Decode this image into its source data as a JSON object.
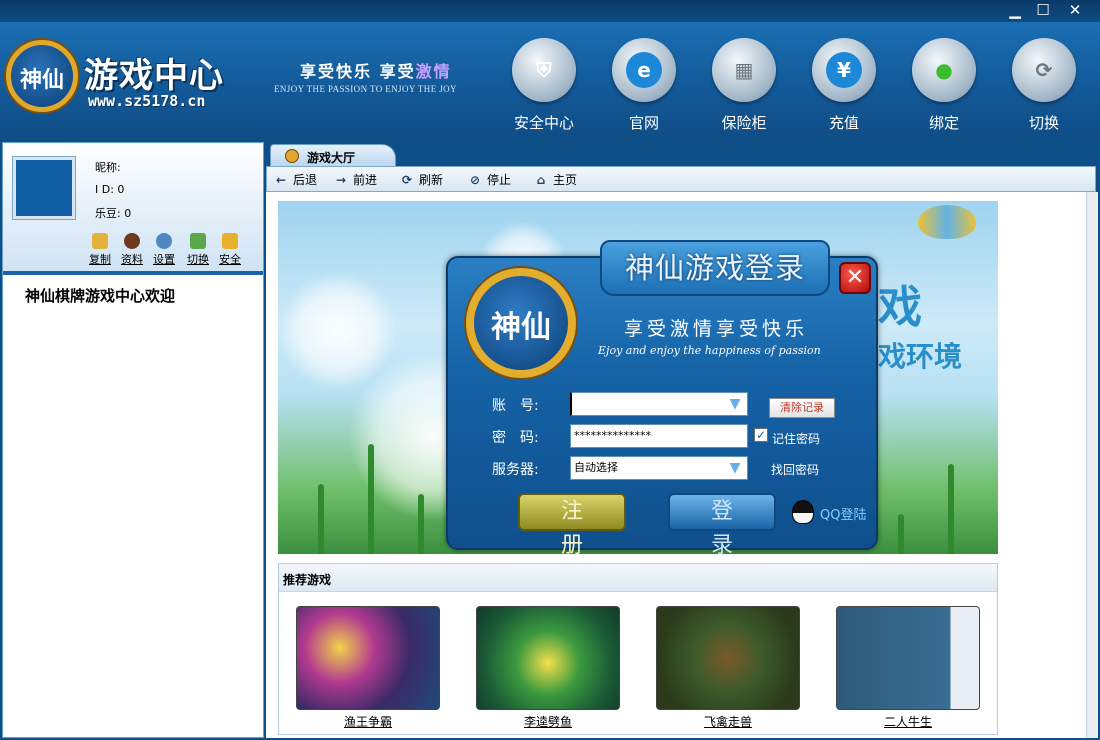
{
  "window": {
    "controls": {
      "minimize": "▁",
      "maximize": "☐",
      "close": "✕"
    }
  },
  "header": {
    "logo_badge_text": "神仙",
    "logo_title": "游戏中心",
    "logo_url": "www.sz5178.cn",
    "slogan_cn_main": "享受快乐 享受",
    "slogan_cn_highlight": "激情",
    "slogan_en": "ENJOY THE PASSION TO ENJOY THE JOY",
    "nav": [
      {
        "label": "安全中心",
        "icon": "shield-icon",
        "glyph": "⛨",
        "color": "#1b1b1b"
      },
      {
        "label": "官网",
        "icon": "browser-icon",
        "glyph": "e",
        "color": "#1e88d8"
      },
      {
        "label": "保险柜",
        "icon": "safe-icon",
        "glyph": "▦",
        "color": "#8a969f"
      },
      {
        "label": "充值",
        "icon": "yen-icon",
        "glyph": "¥",
        "color": "#1e88d8"
      },
      {
        "label": "绑定",
        "icon": "wechat-icon",
        "glyph": "●",
        "color": "#3dbb2f"
      },
      {
        "label": "切换",
        "icon": "switch-icon",
        "glyph": "⟳",
        "color": "#8a969f"
      }
    ]
  },
  "user": {
    "nickname_label": "昵称:",
    "id_label": "I D: 0",
    "beans_label": "乐豆: 0",
    "actions": [
      {
        "label": "复制",
        "icon": "copy-icon",
        "color": "#e3b23c"
      },
      {
        "label": "资料",
        "icon": "profile-icon",
        "color": "#6b3a1f"
      },
      {
        "label": "设置",
        "icon": "gear-icon",
        "color": "#4f86c2"
      },
      {
        "label": "切换",
        "icon": "switch-user-icon",
        "color": "#5aa84a"
      },
      {
        "label": "安全",
        "icon": "lock-icon",
        "color": "#e6b02a"
      }
    ]
  },
  "welcome": "神仙棋牌游戏中心欢迎",
  "tab": {
    "label": "游戏大厅"
  },
  "toolbar": {
    "back": "后退",
    "forward": "前进",
    "refresh": "刷新",
    "stop": "停止",
    "home": "主页"
  },
  "banner": {
    "text1": "戏",
    "text2": "戏环境"
  },
  "login": {
    "title": "神仙游戏登录",
    "badge_text": "神仙",
    "slogan": "享受激情享受快乐",
    "slogan_en": "Ejoy and enjoy the happiness of passion",
    "account_label": "账　号:",
    "account_value": "",
    "clear_button": "清除记录",
    "password_label": "密　码:",
    "password_value": "**************",
    "remember_label": "记住密码",
    "remember_checked": true,
    "server_label": "服务器:",
    "server_value": "自动选择",
    "find_password": "找回密码",
    "register_button": "注册",
    "login_button": "登录",
    "qq_login": "QQ登陆"
  },
  "recommended": {
    "title": "推荐游戏",
    "games": [
      {
        "name": "渔王争霸"
      },
      {
        "name": "李逵劈鱼"
      },
      {
        "name": "飞禽走兽"
      },
      {
        "name": "二人牛生"
      }
    ]
  }
}
